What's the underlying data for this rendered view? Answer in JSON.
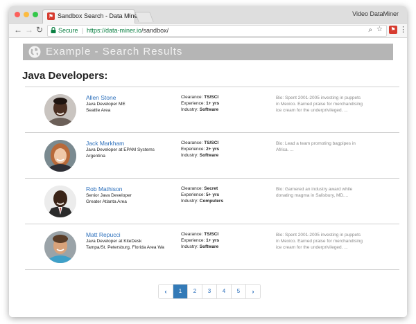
{
  "browser": {
    "tab_title": "Sandbox Search - Data Miner",
    "tab_close": "×",
    "extension_title": "Video DataMiner",
    "secure_label": "Secure",
    "url_scheme_host": "https://data-miner.io",
    "url_path": "/sandbox/"
  },
  "page": {
    "banner_title": "Example - Search Results",
    "heading": "Java Developers:",
    "results": [
      {
        "name": "Allen Stone",
        "title": "Java Developer ME",
        "location": "Seattle Area",
        "clearance_label": "Clearance:",
        "clearance": "TS/SCI",
        "experience_label": "Experience:",
        "experience": "1+ yrs",
        "industry_label": "Industry:",
        "industry": "Software",
        "bio": "Bio: Spent 2001-2005 investing in puppets in Mexico. Earned praise for merchandising ice cream for the underprivileged. ..."
      },
      {
        "name": "Jack Markham",
        "title": "Java Developer at EPAM Systems",
        "location": "Argentina",
        "clearance_label": "Clearance:",
        "clearance": "TS/SCI",
        "experience_label": "Experience:",
        "experience": "2+ yrs",
        "industry_label": "Industry:",
        "industry": "Software",
        "bio": "Bio: Lead a team promoting bagpipes in Africa. ..."
      },
      {
        "name": "Rob Mathison",
        "title": "Senior Java Developer",
        "location": "Greater Atlanta Area",
        "clearance_label": "Clearance:",
        "clearance": "Secret",
        "experience_label": "Experience:",
        "experience": "5+ yrs",
        "industry_label": "Industry:",
        "industry": "Computers",
        "bio": "Bio: Garnered an industry award while donating magma in Salisbury, MD...."
      },
      {
        "name": "Matt Repucci",
        "title": "Java Developer at KiteDesk",
        "location": "Tampa/St. Petersburg, Florida Area Wa",
        "clearance_label": "Clearance:",
        "clearance": "TS/SCI",
        "experience_label": "Experience:",
        "experience": "1+ yrs",
        "industry_label": "Industry:",
        "industry": "Software",
        "bio": "Bio: Spent 2001-2005 investing in puppets in Mexico. Earned praise for merchandising ice cream for the underprivileged. ..."
      }
    ],
    "pagination": {
      "prev": "‹",
      "pages": [
        "1",
        "2",
        "3",
        "4",
        "5"
      ],
      "active": "1",
      "next": "›"
    }
  },
  "colors": {
    "link": "#2a6ebb",
    "secure": "#0b8043",
    "active_page": "#337ab7",
    "banner": "#b5b5b5"
  }
}
